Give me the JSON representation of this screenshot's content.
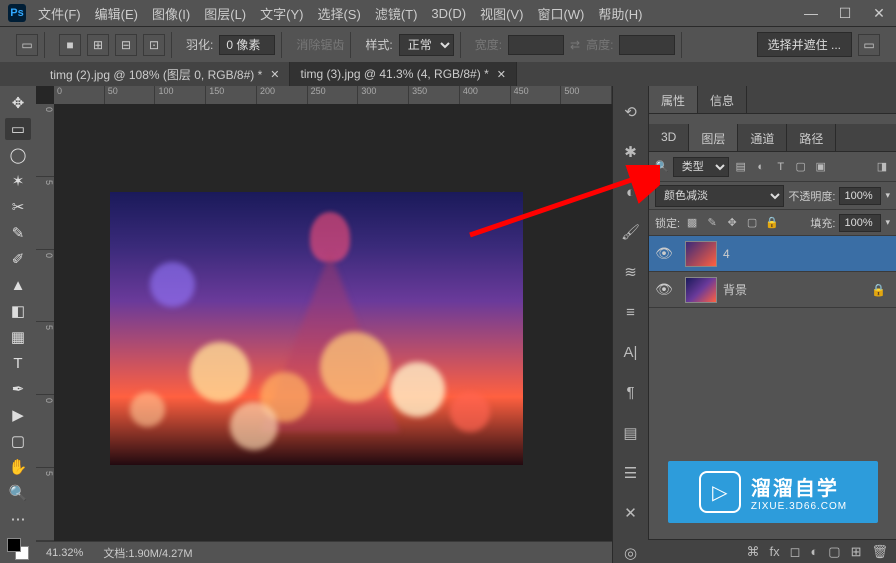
{
  "app": {
    "id": "Ps"
  },
  "menu": [
    "文件(F)",
    "编辑(E)",
    "图像(I)",
    "图层(L)",
    "文字(Y)",
    "选择(S)",
    "滤镜(T)",
    "3D(D)",
    "视图(V)",
    "窗口(W)",
    "帮助(H)"
  ],
  "options": {
    "feather_label": "羽化:",
    "feather_value": "0 像素",
    "antialias": "消除锯齿",
    "style_label": "样式:",
    "style_value": "正常",
    "width_label": "宽度:",
    "height_label": "高度:",
    "select_mask": "选择并遮住 ..."
  },
  "tabs": [
    {
      "title": "timg (2).jpg @ 108% (图层 0, RGB/8#) *"
    },
    {
      "title": "timg (3).jpg @ 41.3% (4, RGB/8#) *"
    }
  ],
  "ruler_h": [
    "0",
    "50",
    "100",
    "150",
    "200",
    "250",
    "300",
    "350",
    "400",
    "450",
    "500"
  ],
  "ruler_v": [
    "0",
    "5",
    "0",
    "5",
    "0",
    "5"
  ],
  "status": {
    "zoom": "41.32%",
    "doc_label": "文档:",
    "doc_value": "1.90M/4.27M"
  },
  "panels": {
    "top": {
      "tabs": [
        "属性",
        "信息"
      ]
    },
    "main": {
      "tabs": [
        "3D",
        "图层",
        "通道",
        "路径"
      ],
      "active": 1
    },
    "filter_label": "类型",
    "blend_mode": "颜色减淡",
    "opacity_label": "不透明度:",
    "opacity_value": "100%",
    "lock_label": "锁定:",
    "fill_label": "填充:",
    "fill_value": "100%",
    "layers": [
      {
        "name": "4",
        "selected": true,
        "locked": false
      },
      {
        "name": "背景",
        "selected": false,
        "locked": true
      }
    ]
  },
  "watermark": {
    "title": "溜溜自学",
    "sub": "ZIXUE.3D66.COM"
  }
}
